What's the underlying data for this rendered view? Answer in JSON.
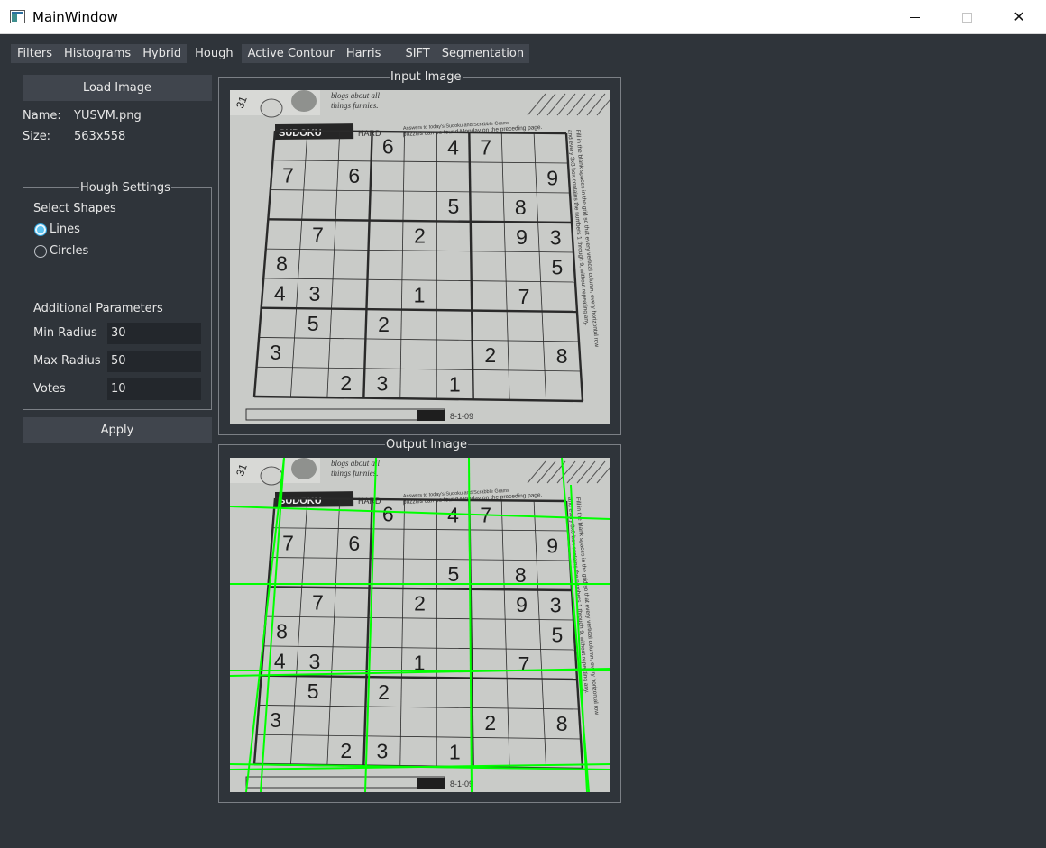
{
  "window": {
    "title": "MainWindow",
    "minimize": "—",
    "maximize": "□",
    "close": "✕"
  },
  "tabs": [
    "Filters",
    "Histograms",
    "Hybrid",
    "Hough",
    "Active Contour",
    "Harris",
    "SIFT",
    "Segmentation"
  ],
  "active_tab": "Hough",
  "left_panel": {
    "load_button": "Load Image",
    "name_label": "Name:",
    "name_value": "YUSVM.png",
    "size_label": "Size:",
    "size_value": "563x558",
    "apply_button": "Apply"
  },
  "hough_settings": {
    "title": "Hough Settings",
    "select_shapes": "Select Shapes",
    "options": [
      {
        "label": "Lines",
        "checked": true
      },
      {
        "label": "Circles",
        "checked": false
      }
    ],
    "additional": "Additional Parameters",
    "params": [
      {
        "label": "Min Radius",
        "value": "30"
      },
      {
        "label": "Max Radius",
        "value": "50"
      },
      {
        "label": "Votes",
        "value": "10"
      }
    ]
  },
  "input_image": {
    "title": "Input Image",
    "page_text": {
      "header_line1": "blogs about all",
      "header_line2": "things funnies.",
      "puzzle": "SUDOKU",
      "level": "HARD",
      "answers": "Answers to today's Sudoku and Scrabble Grams",
      "answers2": "puzzles can be found Monday on the preceding page.",
      "side": "Fill in the blank spaces in the grid so that every vertical column, every horizontal row",
      "side2": "and every 3x3 box contains the numbers 1 through 9, without repeating any.",
      "date": "8-1-09",
      "page_num": "31"
    },
    "digits": [
      [
        "",
        "",
        "",
        "6",
        "",
        "4",
        "7",
        "",
        ""
      ],
      [
        "7",
        "",
        "6",
        "",
        "",
        "",
        "",
        "",
        "9"
      ],
      [
        "",
        "",
        "",
        "",
        "",
        "5",
        "",
        "8",
        ""
      ],
      [
        "",
        "7",
        "",
        "",
        "2",
        "",
        "",
        "9",
        "3"
      ],
      [
        "8",
        "",
        "",
        "",
        "",
        "",
        "",
        "",
        "5"
      ],
      [
        "4",
        "3",
        "",
        "",
        "1",
        "",
        "",
        "7",
        ""
      ],
      [
        "",
        "5",
        "",
        "2",
        "",
        "",
        "",
        "",
        ""
      ],
      [
        "3",
        "",
        "",
        "",
        "",
        "",
        "2",
        "",
        "8"
      ],
      [
        "",
        "",
        "2",
        "3",
        "",
        "1",
        "",
        "",
        ""
      ]
    ]
  },
  "output_image": {
    "title": "Output Image",
    "line_color": "#00ff00"
  }
}
